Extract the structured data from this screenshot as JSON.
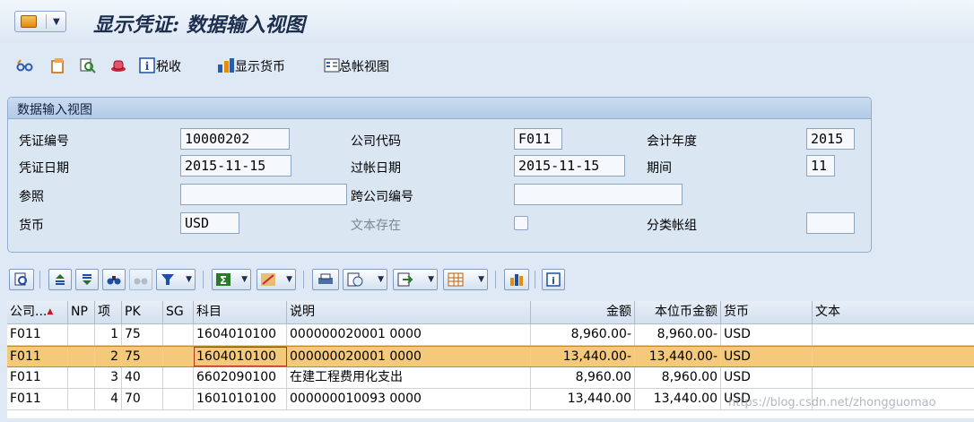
{
  "window": {
    "title": "显示凭证: 数据输入视图"
  },
  "toolbar": {
    "tax_label": "税收",
    "display_currency_label": "显示货币",
    "gl_view_label": "总帐视图"
  },
  "header_panel": {
    "title": "数据输入视图",
    "fields": {
      "doc_no_label": "凭证编号",
      "doc_no": "10000202",
      "company_code_label": "公司代码",
      "company_code": "F011",
      "fiscal_year_label": "会计年度",
      "fiscal_year": "2015",
      "doc_date_label": "凭证日期",
      "doc_date": "2015-11-15",
      "posting_date_label": "过帐日期",
      "posting_date": "2015-11-15",
      "period_label": "期间",
      "period": "11",
      "reference_label": "参照",
      "reference": "",
      "cross_cc_label": "跨公司编号",
      "cross_cc": "",
      "currency_label": "货币",
      "currency": "USD",
      "text_exists_label": "文本存在",
      "ledger_group_label": "分类帐组",
      "ledger_group": ""
    }
  },
  "table": {
    "columns": [
      "公司...",
      "NP",
      "项",
      "PK",
      "SG",
      "科目",
      "说明",
      "金额",
      "本位币金额",
      "货币",
      "文本"
    ],
    "rows": [
      [
        "F011",
        "",
        "1",
        "75",
        "",
        "1604010100",
        "000000020001 0000",
        "8,960.00-",
        "8,960.00-",
        "USD",
        ""
      ],
      [
        "F011",
        "",
        "2",
        "75",
        "",
        "1604010100",
        "000000020001 0000",
        "13,440.00-",
        "13,440.00-",
        "USD",
        ""
      ],
      [
        "F011",
        "",
        "3",
        "40",
        "",
        "6602090100",
        "在建工程费用化支出",
        "8,960.00",
        "8,960.00",
        "USD",
        ""
      ],
      [
        "F011",
        "",
        "4",
        "70",
        "",
        "1601010100",
        "000000010093 0000",
        "13,440.00",
        "13,440.00",
        "USD",
        ""
      ]
    ],
    "selected_row": 2
  },
  "watermark": "https://blog.csdn.net/zhongguomao",
  "colors": {
    "selected_row": "#f5c97a",
    "background": "#dfe9f5",
    "title": "#1c2e4e"
  },
  "icons": [
    "menu-icon",
    "glasses-icon",
    "document-icon",
    "search-doc-icon",
    "hat-icon",
    "info-icon",
    "currency-icon",
    "ledger-icon"
  ]
}
